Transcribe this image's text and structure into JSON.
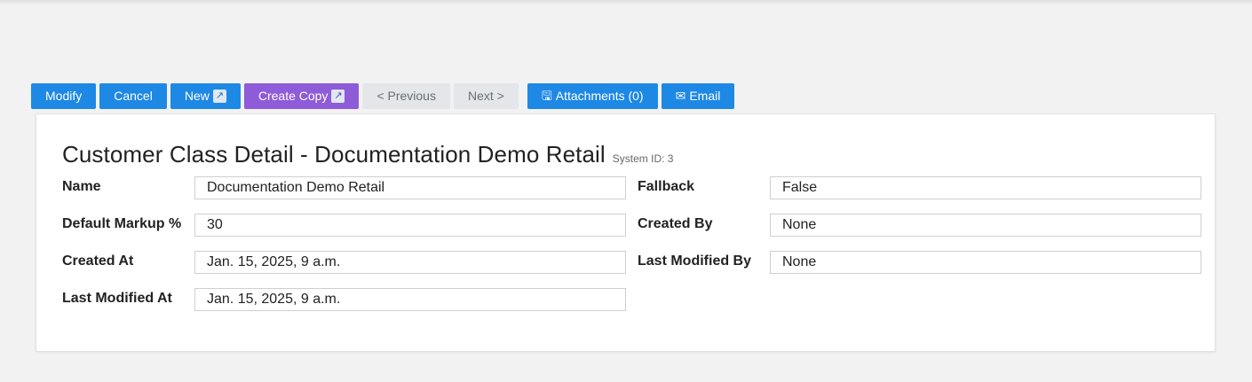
{
  "toolbar": {
    "modify": "Modify",
    "cancel": "Cancel",
    "new": "New",
    "create_copy": "Create Copy",
    "previous": "< Previous",
    "next": "Next >",
    "attachments": "Attachments (0)",
    "email": "Email",
    "ext_glyph": "↗",
    "attach_glyph": "🖫",
    "email_glyph": "✉",
    "colors": {
      "primary": "#1e88e5",
      "purple": "#8e5bd9",
      "disabled": "#e4e6e9"
    }
  },
  "detail": {
    "title": "Customer Class Detail - Documentation Demo Retail",
    "system_id": "System ID: 3",
    "fields": {
      "name": {
        "label": "Name",
        "value": "Documentation Demo Retail"
      },
      "default_markup": {
        "label": "Default Markup %",
        "value": "30"
      },
      "created_at": {
        "label": "Created At",
        "value": "Jan. 15, 2025, 9 a.m."
      },
      "last_modified_at": {
        "label": "Last Modified At",
        "value": "Jan. 15, 2025, 9 a.m."
      },
      "fallback": {
        "label": "Fallback",
        "value": "False"
      },
      "created_by": {
        "label": "Created By",
        "value": "None"
      },
      "last_modified_by": {
        "label": "Last Modified By",
        "value": "None"
      }
    }
  }
}
